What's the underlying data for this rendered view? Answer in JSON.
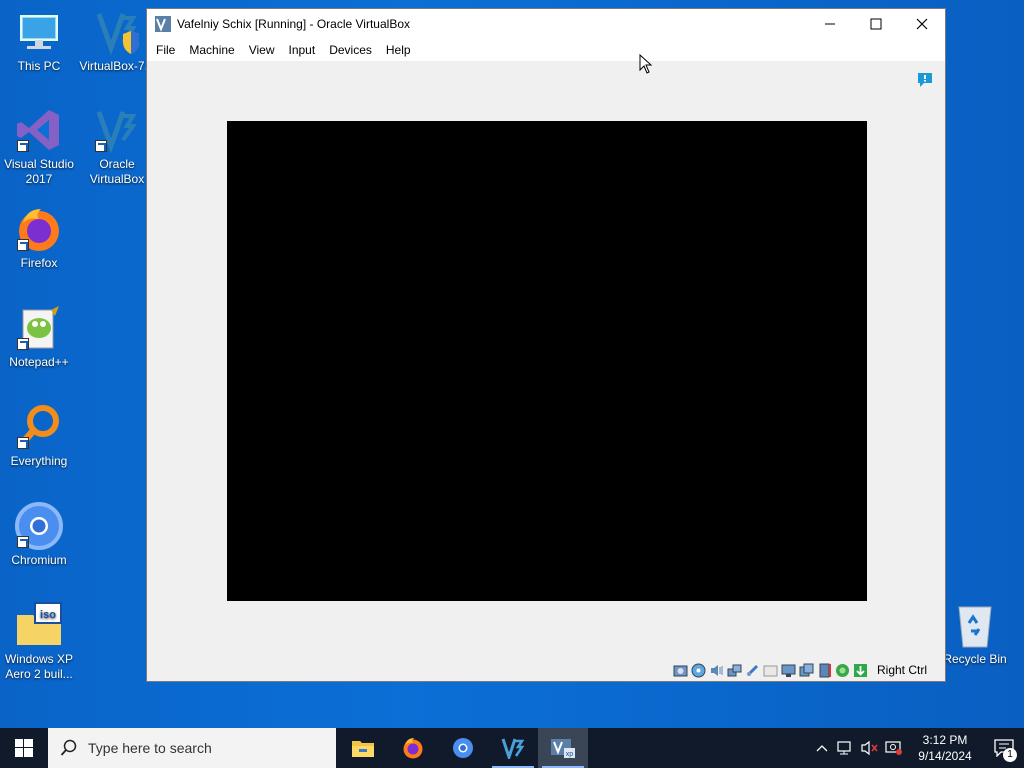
{
  "desktop": {
    "icons": [
      {
        "label": "This PC"
      },
      {
        "label": "VirtualBox-7..."
      },
      {
        "label": "Visual Studio 2017"
      },
      {
        "label": "Oracle VirtualBox"
      },
      {
        "label": "Firefox"
      },
      {
        "label": "Notepad++"
      },
      {
        "label": "Everything"
      },
      {
        "label": "Chromium"
      },
      {
        "label": "Windows XP Aero 2 buil..."
      },
      {
        "label": "Recycle Bin"
      }
    ]
  },
  "window": {
    "title": "Vafelniy  Schix [Running] - Oracle VirtualBox",
    "menu": [
      "File",
      "Machine",
      "View",
      "Input",
      "Devices",
      "Help"
    ],
    "host_key": "Right Ctrl"
  },
  "taskbar": {
    "search_placeholder": "Type here to search",
    "time": "3:12 PM",
    "date": "9/14/2024",
    "notification_count": "1"
  },
  "colors": {
    "desktop_blue": "#0b6fd6",
    "taskbar": "#101a2a",
    "window_bg": "#f0f0f0"
  }
}
